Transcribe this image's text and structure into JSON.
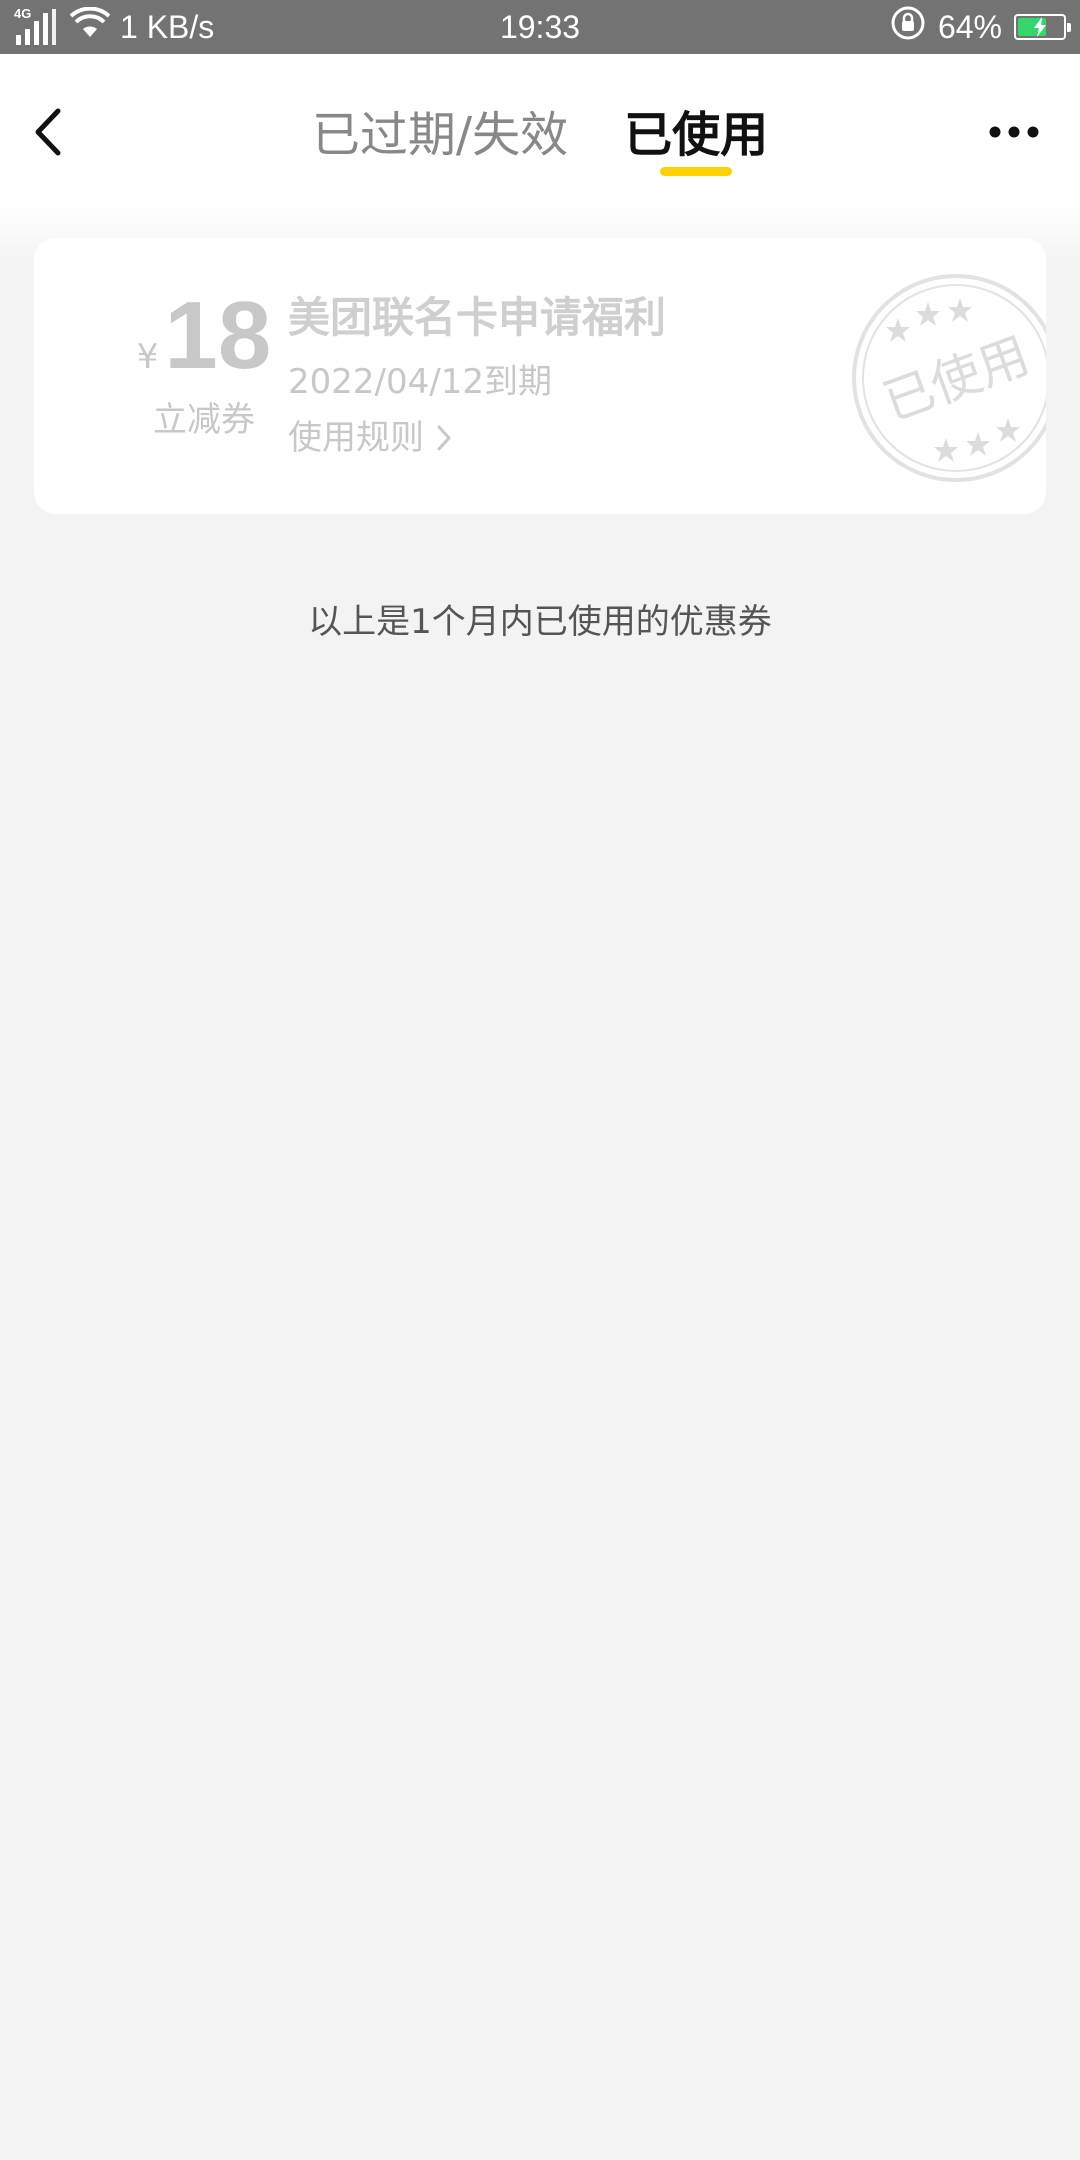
{
  "status_bar": {
    "network_type": "4G",
    "speed": "1 KB/s",
    "time": "19:33",
    "battery_percent": "64%",
    "battery_level": 0.64,
    "battery_color": "#36d66e"
  },
  "header": {
    "tabs": [
      {
        "label": "已过期/失效",
        "active": false
      },
      {
        "label": "已使用",
        "active": true
      }
    ],
    "accent_color": "#ffd100",
    "back_icon": "chevron-left-icon",
    "more_icon": "more-dots-icon"
  },
  "coupon": {
    "currency": "¥",
    "amount": "18",
    "type": "立减券",
    "title": "美团联名卡申请福利",
    "expiry": "2022/04/12到期",
    "rules_label": "使用规则",
    "stamp_text": "已使用"
  },
  "footer_note": "以上是1个月内已使用的优惠券"
}
